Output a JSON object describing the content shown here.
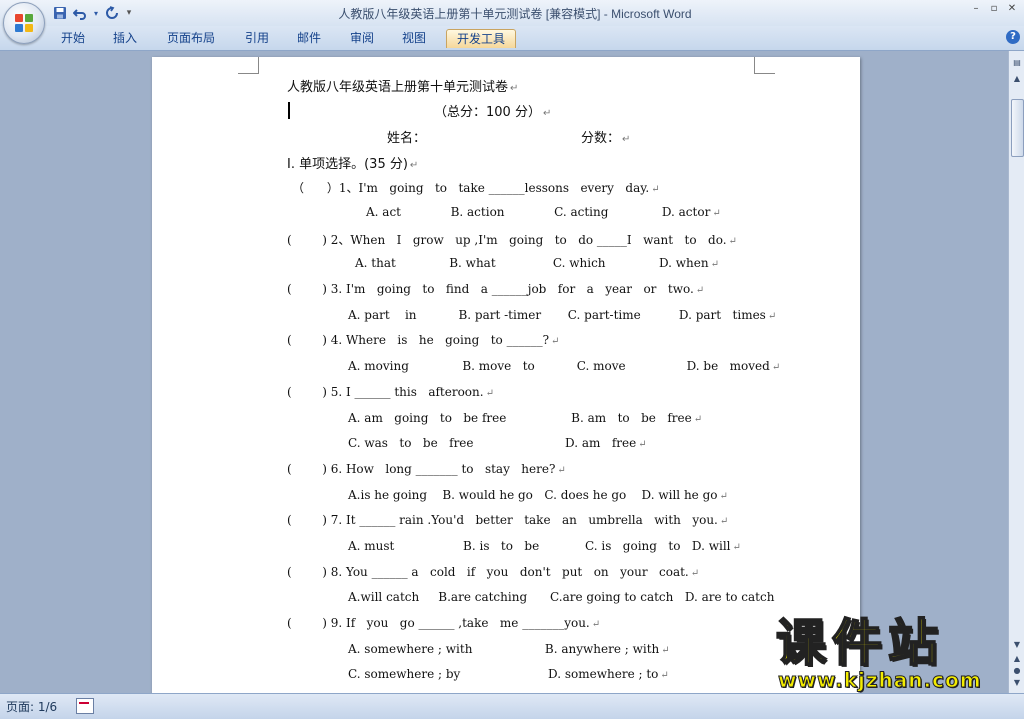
{
  "window": {
    "title": "人教版八年级英语上册第十单元测试卷 [兼容模式] - Microsoft Word",
    "controls": [
      "minimize-icon",
      "restore-icon",
      "close-icon"
    ]
  },
  "quick_access": [
    "save-icon",
    "undo-icon",
    "redo-icon",
    "customize-icon"
  ],
  "ribbon": {
    "tabs": [
      "开始",
      "插入",
      "页面布局",
      "引用",
      "邮件",
      "审阅",
      "视图",
      "开发工具"
    ],
    "active_tab": "开发工具",
    "help": "?"
  },
  "document": {
    "title": "人教版八年级英语上册第十单元测试卷",
    "total_score": "（总分：100 分）",
    "name_label": "姓名：",
    "score_label": "分数：",
    "section": "I. 单项选择。(35 分)",
    "pilcrow": "↵",
    "questions": [
      {
        "stem": "（      ）1、I'm   going   to   take ______lessons   every   day.",
        "options": [
          "A. act             B. action             C. acting              D. actor"
        ]
      },
      {
        "stem": "(        ) 2、When   I   grow   up ,I'm   going   to   do _____I   want   to   do.",
        "options": [
          "A. that              B. what               C. which              D. when"
        ]
      },
      {
        "stem": "(        ) 3. I'm   going   to   find   a ______job   for   a   year   or   two.",
        "options": [
          "A. part    in           B. part -timer       C. part-time          D. part   times"
        ]
      },
      {
        "stem": "(        ) 4. Where   is   he   going   to ______?",
        "options": [
          "A. moving              B. move   to           C. move                D. be   moved"
        ]
      },
      {
        "stem": "(        ) 5. I ______ this   afteroon.",
        "options": [
          "A. am   going   to   be free                 B. am   to   be   free",
          "C. was   to   be   free                        D. am   free"
        ]
      },
      {
        "stem": "(        ) 6. How   long _______ to   stay   here?",
        "options": [
          "A.is he going    B. would he go   C. does he go    D. will he go"
        ]
      },
      {
        "stem": "(        ) 7. It ______ rain .You'd   better   take   an   umbrella   with   you.",
        "options": [
          "A. must                  B. is   to   be            C. is   going   to   D. will"
        ]
      },
      {
        "stem": "(        ) 8. You ______ a   cold   if   you   don't   put   on   your   coat.",
        "options": [
          "A.will catch     B.are catching      C.are going to catch   D. are to catch"
        ]
      },
      {
        "stem": "(        ) 9. If   you   go ______ ,take   me _______you.",
        "options": [
          "A. somewhere ; with                   B. anywhere ; with",
          "C. somewhere ; by                       D. somewhere ; to"
        ]
      }
    ]
  },
  "status": {
    "page": "页面: 1/6",
    "icon": "proofing-icon"
  },
  "watermark": {
    "text": "课件站",
    "url": "www.kjzhan.com"
  }
}
